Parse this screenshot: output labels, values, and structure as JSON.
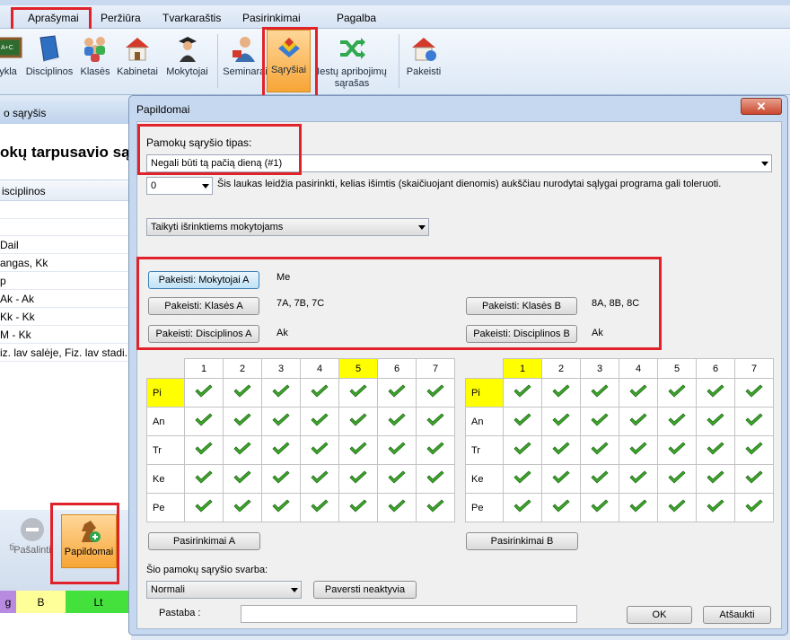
{
  "menu": {
    "items": [
      {
        "label": "Aprašymai"
      },
      {
        "label": "Peržiūra"
      },
      {
        "label": "Tvarkaraštis"
      },
      {
        "label": "Pasirinkimai"
      },
      {
        "label": "Pagalba"
      }
    ]
  },
  "ribbon": {
    "buttons": [
      {
        "label": "ykla",
        "icon": "blackboard-icon"
      },
      {
        "label": "Disciplinos",
        "icon": "book-icon"
      },
      {
        "label": "Klasės",
        "icon": "people-group-icon"
      },
      {
        "label": "Kabinetai",
        "icon": "house-icon"
      },
      {
        "label": "Mokytojai",
        "icon": "teacher-icon"
      },
      {
        "label": "Seminarai",
        "icon": "seminar-icon"
      },
      {
        "label": "Sąryšiai",
        "icon": "relations-icon"
      },
      {
        "label": "Iestų apribojimų",
        "label2": "sąrašas",
        "icon": "shuffle-icon"
      },
      {
        "label": "Pakeisti",
        "icon": "house-replace-icon"
      }
    ]
  },
  "bg_window": {
    "title": "o sąryšis",
    "heading": "okų tarpusavio sąry",
    "column_header": "isciplinos",
    "rows": [
      "Dail",
      "angas, Kk",
      "p",
      "Ak - Ak",
      "Kk - Kk",
      "M - Kk",
      "iz. lav salėje, Fiz. lav stadi..."
    ],
    "bottom_buttons": [
      {
        "label": "ti"
      },
      {
        "label": "Pašalinti"
      },
      {
        "label": "Papildomai"
      }
    ],
    "color_strip": [
      "g",
      "B",
      "Lt"
    ]
  },
  "dialog": {
    "title": "Papildomai",
    "close_label": "✕",
    "type_label": "Pamokų sąryšio tipas:",
    "type_value": "Negali būti tą pačią dieną (#1)",
    "tolerance_value": "0",
    "tolerance_text": "Šis laukas leidžia pasirinkti, kelias išimtis (skaičiuojant dienomis) aukščiau nurodytai sąlygai programa gali toleruoti.",
    "apply_value": "Taikyti išrinktiems mokytojams",
    "change_teachers_a": "Pakeisti: Mokytojai A",
    "teachers_a_value": "Me",
    "change_classes_a": "Pakeisti: Klasės A",
    "classes_a_value": "7A, 7B, 7C",
    "change_subjects_a": "Pakeisti: Disciplinos A",
    "subjects_a_value": "Ak",
    "change_classes_b": "Pakeisti: Klasės B",
    "classes_b_value": "8A, 8B, 8C",
    "change_subjects_b": "Pakeisti: Disciplinos B",
    "subjects_b_value": "Ak",
    "periods": [
      "1",
      "2",
      "3",
      "4",
      "5",
      "6",
      "7"
    ],
    "days": [
      "Pi",
      "An",
      "Tr",
      "Ke",
      "Pe"
    ],
    "grid_a_highlight_period": "5",
    "grid_a_highlight_day": "Pi",
    "grid_b_highlight_period": "1",
    "grid_b_highlight_day": "Pi",
    "options_a": "Pasirinkimai A",
    "options_b": "Pasirinkimai B",
    "importance_label": "Šio pamokų sąryšio svarba:",
    "importance_value": "Normali",
    "deactivate": "Paversti neaktyvia",
    "note_label": "Pastaba :",
    "note_value": "",
    "ok": "OK",
    "cancel": "Atšaukti"
  },
  "colors": {
    "highlight": "#ffff00",
    "check": "#3ea52b",
    "red_outline": "#e0232a"
  }
}
